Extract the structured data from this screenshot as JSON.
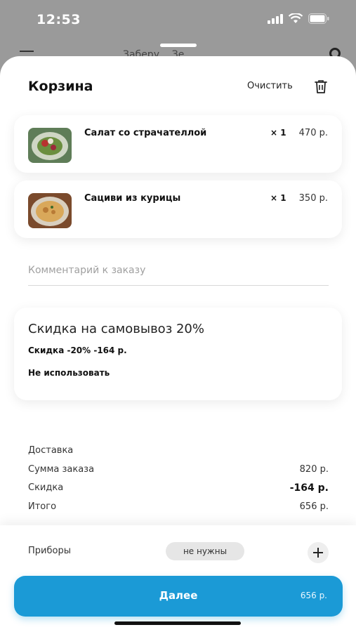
{
  "status": {
    "time": "12:53"
  },
  "background": {
    "title": "Заберу... Зе..."
  },
  "cart": {
    "title": "Корзина",
    "clear_label": "Очистить",
    "items": [
      {
        "name": "Салат со страчателлой",
        "qty": "× 1",
        "price": "470 р."
      },
      {
        "name": "Сациви из курицы",
        "qty": "× 1",
        "price": "350 р."
      }
    ],
    "comment_placeholder": "Комментарий к заказу"
  },
  "promo": {
    "title": "Скидка на самовывоз 20%",
    "option_use": "Скидка -20% -164 р.",
    "option_skip": "Не использовать"
  },
  "summary": {
    "delivery_label": "Доставка",
    "subtotal_label": "Сумма заказа",
    "subtotal_value": "820 р.",
    "discount_label": "Скидка",
    "discount_value": "-164 р.",
    "total_label": "Итого",
    "total_value": "656 р."
  },
  "cutlery": {
    "label": "Приборы",
    "value": "не нужны"
  },
  "next": {
    "label": "Далее",
    "price": "656 р."
  },
  "colors": {
    "accent": "#1b9ad6",
    "chip": "#e6e6e6"
  }
}
